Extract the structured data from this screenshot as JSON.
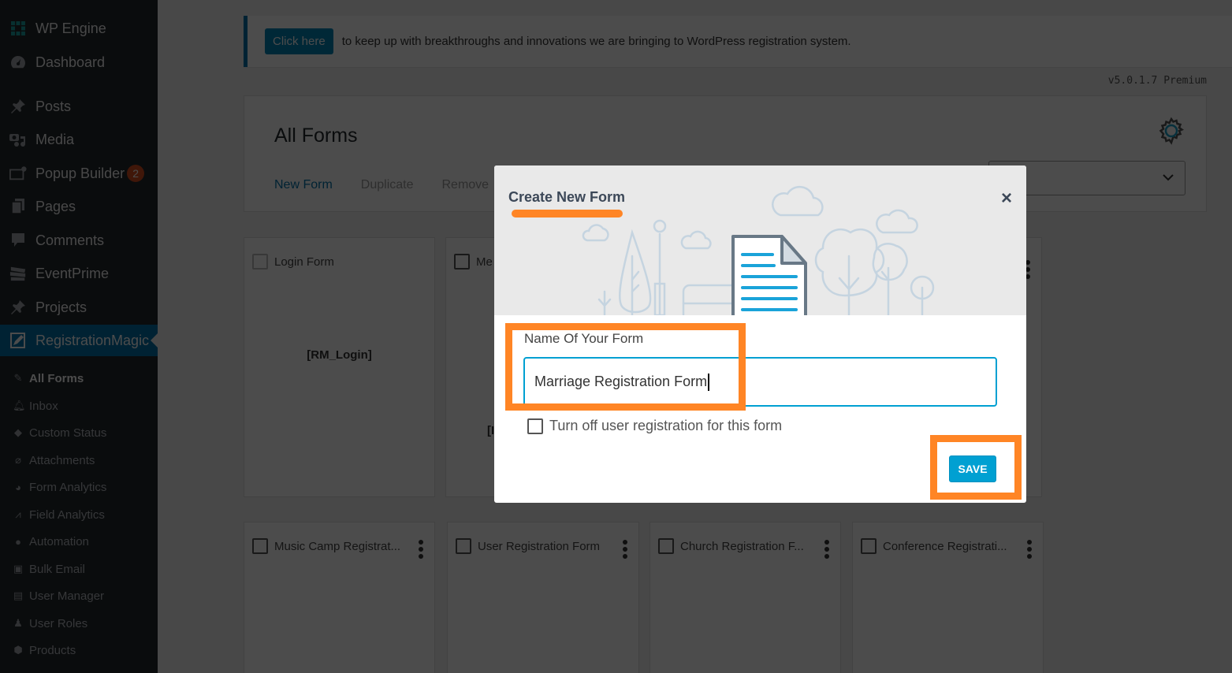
{
  "sidebar": {
    "menu": [
      {
        "label": "WP Engine",
        "icon": "grid-icon"
      },
      {
        "label": "Dashboard",
        "icon": "dashboard-icon"
      },
      {
        "label": "Posts",
        "icon": "pin-icon"
      },
      {
        "label": "Media",
        "icon": "media-icon"
      },
      {
        "label": "Popup Builder",
        "icon": "popup-icon",
        "badge": "2"
      },
      {
        "label": "Pages",
        "icon": "pages-icon"
      },
      {
        "label": "Comments",
        "icon": "comment-icon"
      },
      {
        "label": "EventPrime",
        "icon": "ticket-icon"
      },
      {
        "label": "Projects",
        "icon": "pin-icon"
      },
      {
        "label": "RegistrationMagic",
        "icon": "form-edit-icon",
        "active": true
      }
    ],
    "submenu": [
      {
        "label": "All Forms",
        "icon": "form-edit-icon",
        "current": true
      },
      {
        "label": "Inbox",
        "icon": "bell-icon"
      },
      {
        "label": "Custom Status",
        "icon": "tag-icon"
      },
      {
        "label": "Attachments",
        "icon": "paperclip-icon"
      },
      {
        "label": "Form Analytics",
        "icon": "pie-chart-icon"
      },
      {
        "label": "Field Analytics",
        "icon": "line-chart-icon"
      },
      {
        "label": "Automation",
        "icon": "lightbulb-icon"
      },
      {
        "label": "Bulk Email",
        "icon": "envelope-icon"
      },
      {
        "label": "User Manager",
        "icon": "id-card-icon"
      },
      {
        "label": "User Roles",
        "icon": "user-icon"
      },
      {
        "label": "Products",
        "icon": "cubes-icon"
      }
    ]
  },
  "notice": {
    "button_label": "Click here",
    "text": "to keep up with breakthroughs and innovations we are bringing to WordPress registration system."
  },
  "version": "v5.0.1.7 Premium",
  "header": {
    "title": "All Forms",
    "actions": [
      "New Form",
      "Duplicate",
      "Remove"
    ]
  },
  "cards": [
    {
      "name": "Login Form",
      "shortcode": "[RM_Login]"
    },
    {
      "name": "Me",
      "shortcode": "[I"
    },
    {
      "name": "Music Camp Registrat..."
    },
    {
      "name": "User Registration Form"
    },
    {
      "name": "Church Registration F..."
    },
    {
      "name": "Conference Registrati..."
    }
  ],
  "modal": {
    "title": "Create New Form",
    "close": "×",
    "field_label": "Name Of Your Form",
    "field_value": "Marriage Registration Form",
    "checkbox_label": "Turn off user registration for this form",
    "checkbox_checked": false,
    "save_label": "SAVE"
  },
  "colors": {
    "accent_orange": "#ff8525",
    "primary_blue": "#00a0d2",
    "wp_blue": "#0073aa"
  }
}
